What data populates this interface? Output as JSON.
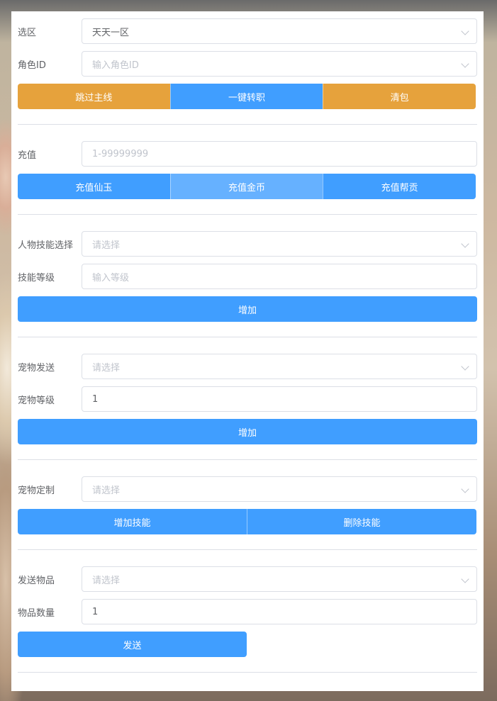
{
  "section_zone": {
    "zone_label": "选区",
    "zone_value": "天天一区",
    "role_label": "角色ID",
    "role_placeholder": "输入角色ID",
    "buttons": [
      "跳过主线",
      "一键转职",
      "清包"
    ]
  },
  "section_recharge": {
    "label": "充值",
    "placeholder": "1-99999999",
    "buttons": [
      "充值仙玉",
      "充值金币",
      "充值帮贡"
    ]
  },
  "section_skill": {
    "skill_label": "人物技能选择",
    "skill_placeholder": "请选择",
    "level_label": "技能等级",
    "level_placeholder": "输入等级",
    "button": "增加"
  },
  "section_pet_send": {
    "pet_label": "宠物发送",
    "pet_placeholder": "请选择",
    "level_label": "宠物等级",
    "level_value": "1",
    "button": "增加"
  },
  "section_pet_custom": {
    "label": "宠物定制",
    "placeholder": "请选择",
    "buttons": [
      "增加技能",
      "删除技能"
    ]
  },
  "section_item": {
    "item_label": "发送物品",
    "item_placeholder": "请选择",
    "qty_label": "物品数量",
    "qty_value": "1",
    "button": "发送"
  },
  "colors": {
    "primary": "#409eff",
    "primary_light": "#66b1ff",
    "warning": "#e6a23c"
  }
}
